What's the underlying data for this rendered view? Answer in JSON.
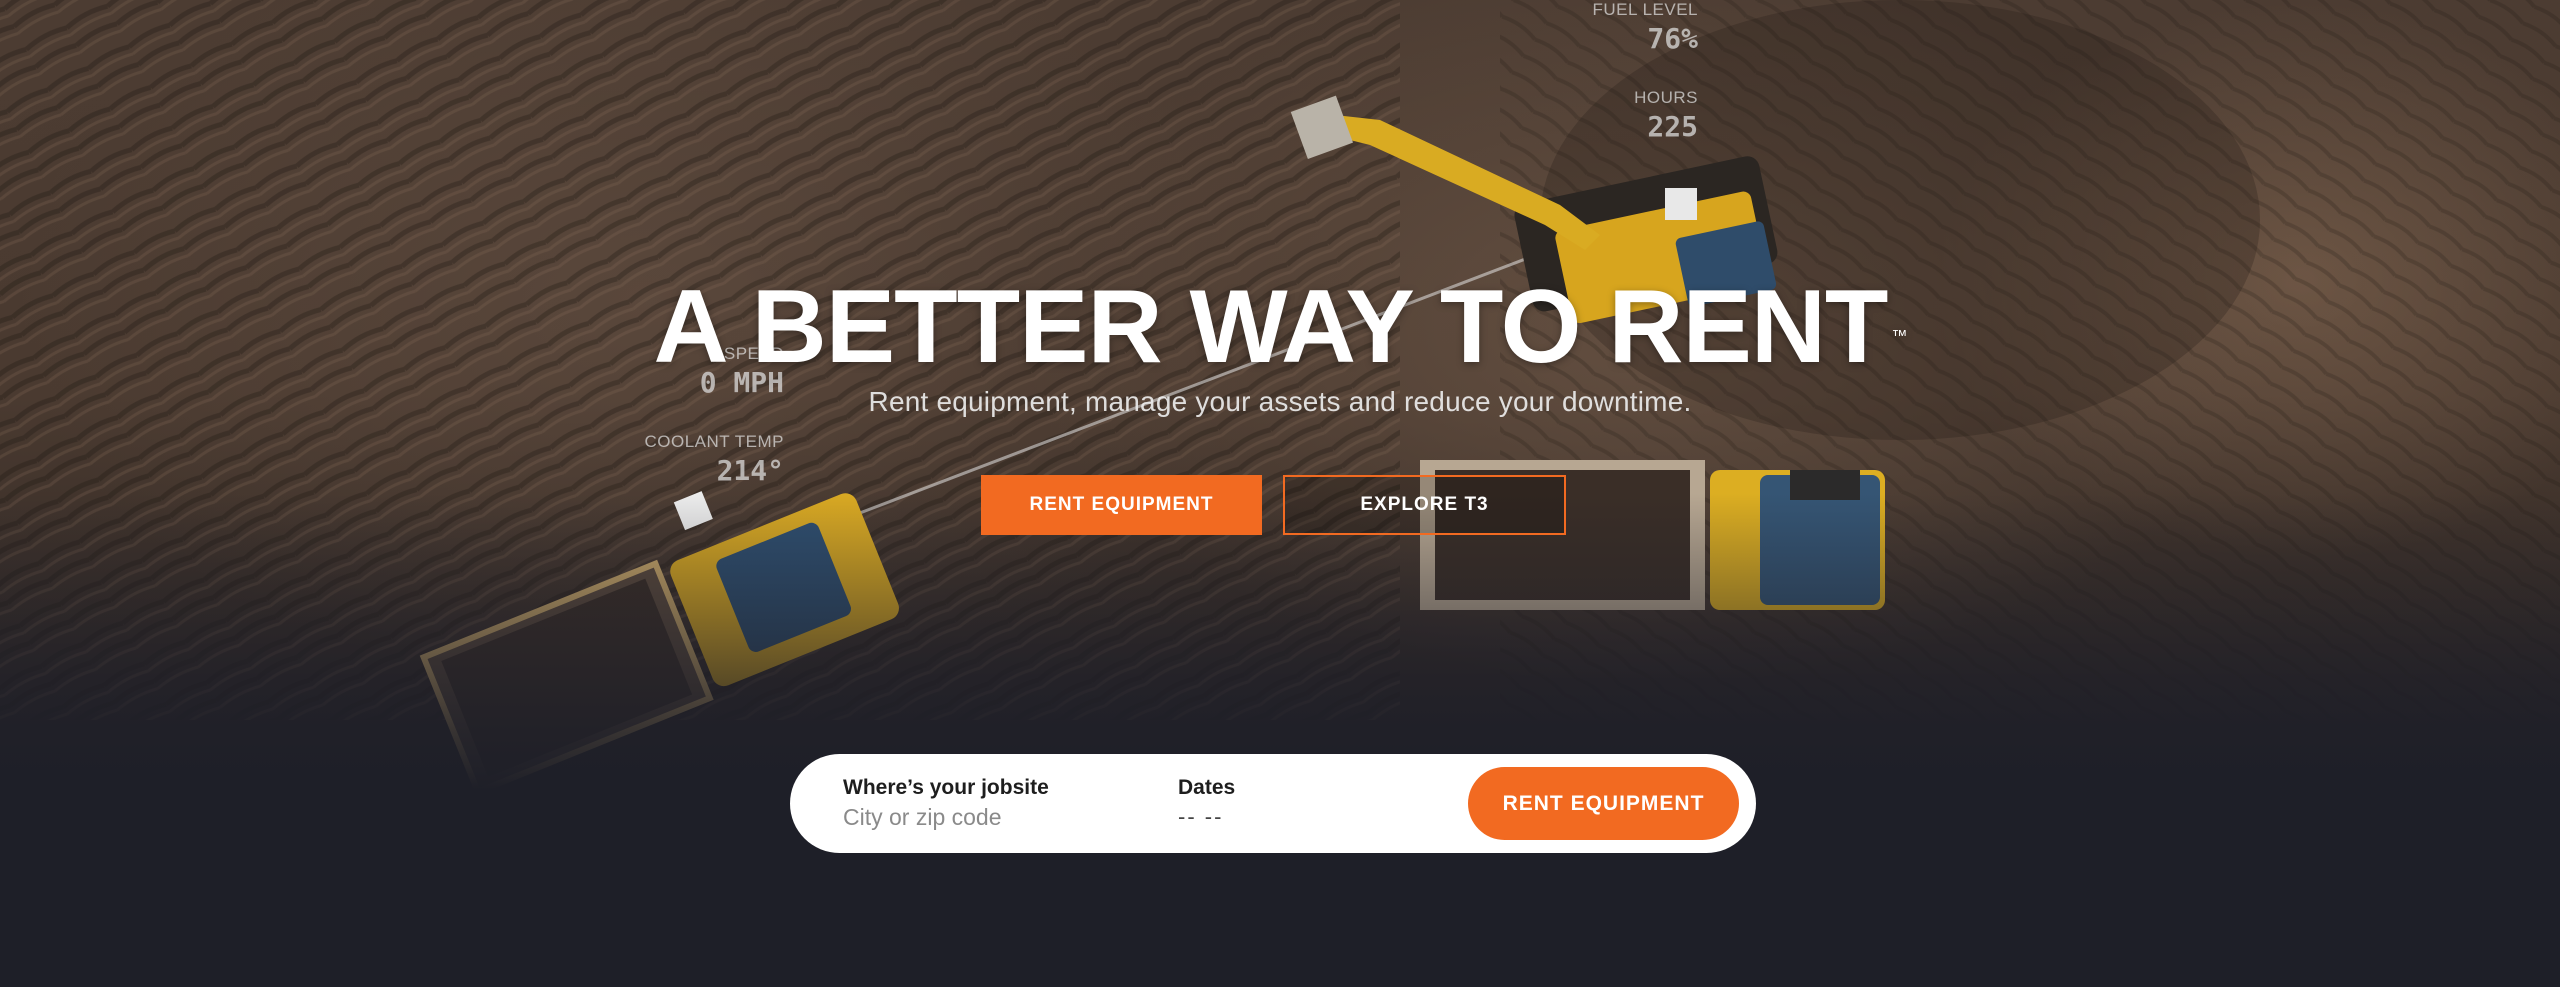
{
  "hero": {
    "title": "A BETTER WAY TO RENT",
    "trademark": "™",
    "subtitle": "Rent equipment, manage your assets and reduce your downtime.",
    "primary_button": "RENT EQUIPMENT",
    "secondary_button": "EXPLORE T3"
  },
  "telemetry": {
    "fuel": {
      "label": "FUEL LEVEL",
      "value": "76%"
    },
    "hours": {
      "label": "HOURS",
      "value": "225"
    },
    "speed": {
      "label": "SPEED",
      "value": "0 MPH"
    },
    "coolant": {
      "label": "COOLANT TEMP",
      "value": "214°"
    }
  },
  "search": {
    "location_label": "Where’s your jobsite",
    "location_placeholder": "City or zip code",
    "dates_label": "Dates",
    "dates_value": "-- --",
    "submit_label": "RENT EQUIPMENT"
  },
  "colors": {
    "accent": "#f26a21",
    "background": "#1e1f28",
    "machine_yellow": "#e3b42a"
  }
}
